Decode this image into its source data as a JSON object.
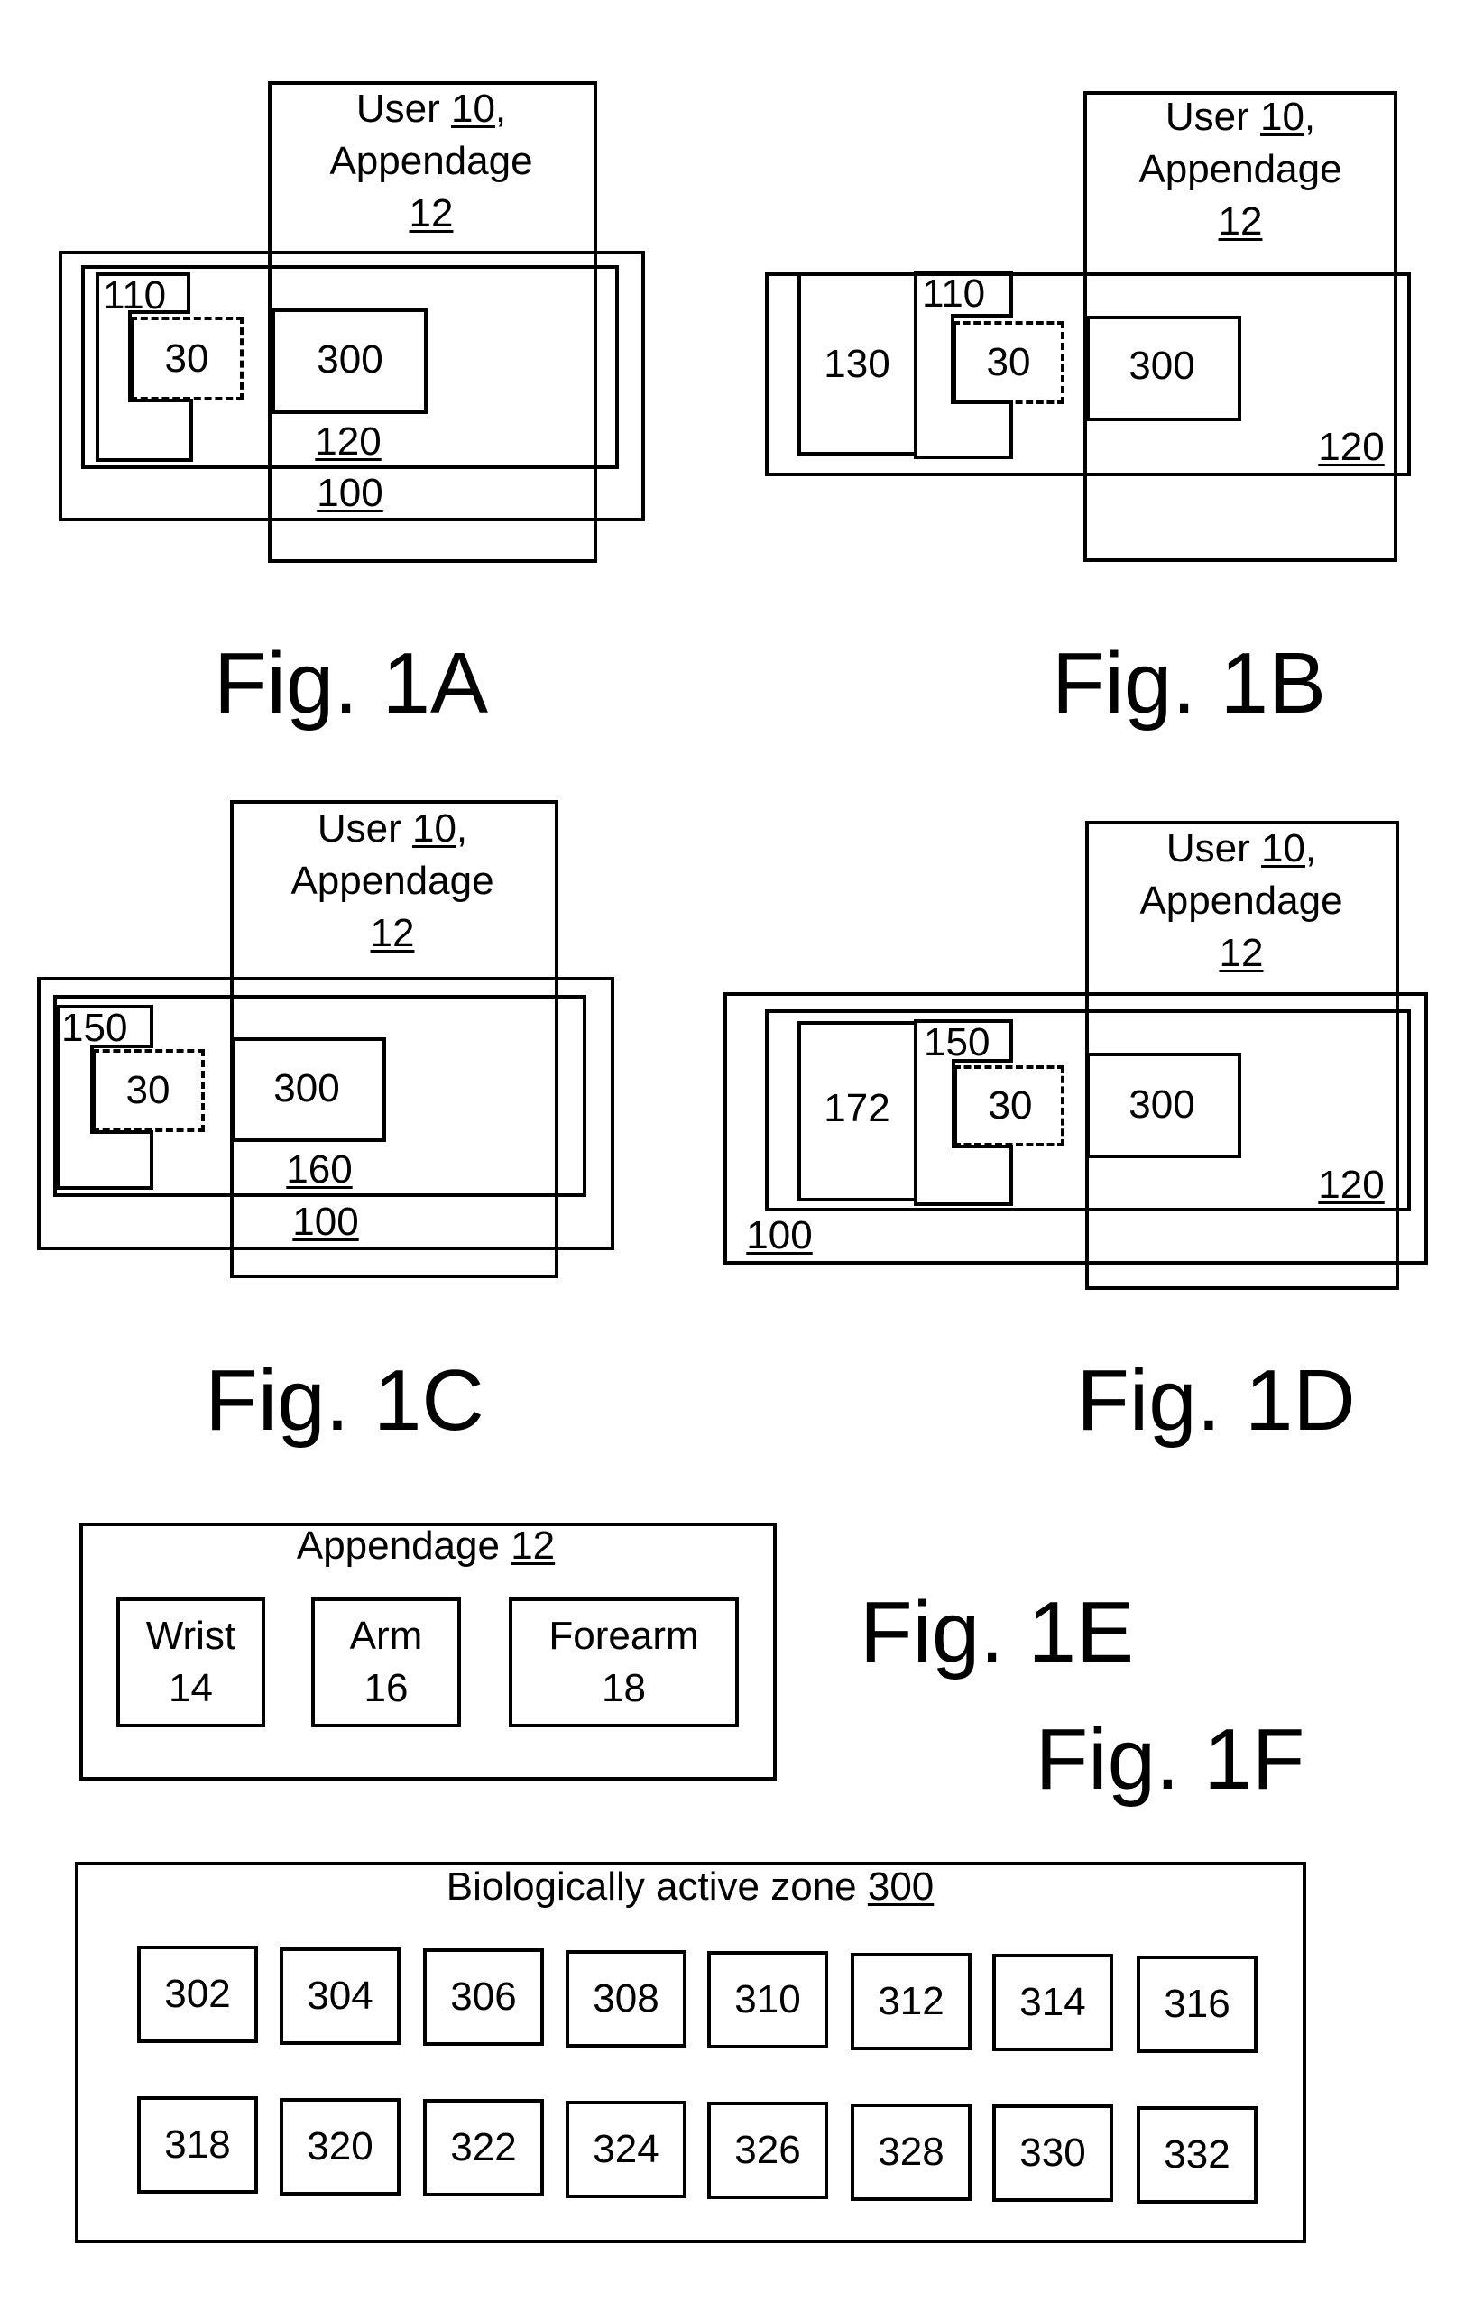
{
  "figures": {
    "fig1a": {
      "caption": "Fig. 1A",
      "user_prefix": "User ",
      "user_ref": "10",
      "user_suffix": ",",
      "appendage_word": "Appendage",
      "appendage_ref": "12",
      "device_ref": "100",
      "band_ref": "120",
      "housing_ref": "110",
      "sensor_ref": "30",
      "zone_ref": "300"
    },
    "fig1b": {
      "caption": "Fig. 1B",
      "user_prefix": "User ",
      "user_ref": "10",
      "user_suffix": ",",
      "appendage_word": "Appendage",
      "appendage_ref": "12",
      "band_ref": "120",
      "module_ref": "130",
      "housing_ref": "110",
      "sensor_ref": "30",
      "zone_ref": "300"
    },
    "fig1c": {
      "caption": "Fig. 1C",
      "user_prefix": "User ",
      "user_ref": "10",
      "user_suffix": ",",
      "appendage_word": "Appendage",
      "appendage_ref": "12",
      "device_ref": "100",
      "band_ref": "160",
      "housing_ref": "150",
      "sensor_ref": "30",
      "zone_ref": "300"
    },
    "fig1d": {
      "caption": "Fig. 1D",
      "user_prefix": "User ",
      "user_ref": "10",
      "user_suffix": ",",
      "appendage_word": "Appendage",
      "appendage_ref": "12",
      "device_ref": "100",
      "band_ref": "120",
      "module_ref": "172",
      "housing_ref": "150",
      "sensor_ref": "30",
      "zone_ref": "300"
    },
    "fig1e": {
      "caption": "Fig. 1E",
      "title_word": "Appendage ",
      "title_ref": "12",
      "parts": [
        {
          "name": "Wrist",
          "ref": "14"
        },
        {
          "name": "Arm",
          "ref": "16"
        },
        {
          "name": "Forearm",
          "ref": "18"
        }
      ]
    },
    "fig1f": {
      "caption": "Fig. 1F",
      "title_word": "Biologically active zone ",
      "title_ref": "300",
      "row1": [
        "302",
        "304",
        "306",
        "308",
        "310",
        "312",
        "314",
        "316"
      ],
      "row2": [
        "318",
        "320",
        "322",
        "324",
        "326",
        "328",
        "330",
        "332"
      ]
    }
  }
}
